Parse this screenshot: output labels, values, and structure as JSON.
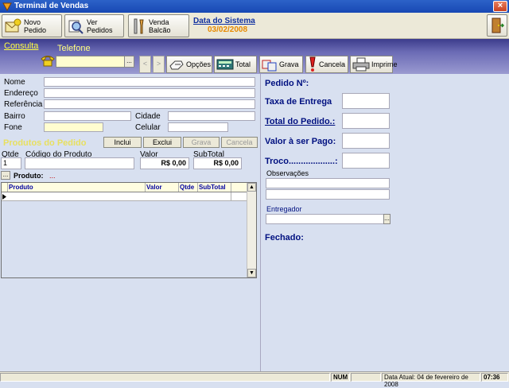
{
  "window": {
    "title": "Terminal de Vendas"
  },
  "toolbar": {
    "novo_pedido": "Novo Pedido",
    "ver_pedidos": "Ver Pedidos",
    "venda_balcao": "Venda Balcão",
    "sysdate_label": "Data do Sistema",
    "sysdate_value": "03/02/2008"
  },
  "consulta": {
    "link": "Consulta",
    "phone_label": "Telefone",
    "phone_value": "",
    "lookup": "...",
    "nav_prev": "<",
    "nav_next": ">",
    "opcoes": "Opções",
    "total": "Total",
    "grava": "Grava",
    "cancela": "Cancela",
    "imprime": "Imprime"
  },
  "customer": {
    "nome": "Nome",
    "endereco": "Endereço",
    "referencia": "Referência",
    "bairro": "Bairro",
    "cidade": "Cidade",
    "fone": "Fone",
    "celular": "Celular"
  },
  "products": {
    "title": "Produtos do Pedido",
    "inclui": "Inclui",
    "exclui": "Exclui",
    "grava": "Grava",
    "cancela": "Cancela",
    "qtde_label": "Qtde",
    "codigo_label": "Código do Produto",
    "valor_label": "Valor",
    "subtotal_label": "SubTotal",
    "qtde_value": "1",
    "valor_value": "R$ 0,00",
    "subtotal_value": "R$ 0,00",
    "produto_lookup": "...",
    "produto_label": "Produto:",
    "produto_value": "...",
    "grid_columns": [
      "Produto",
      "Valor",
      "Qtde",
      "SubTotal"
    ]
  },
  "order": {
    "pedido_no": "Pedido Nº:",
    "taxa_entrega": "Taxa de Entrega",
    "total_pedido": "Total do Pedido.:",
    "valor_pago": "Valor à ser Pago:",
    "troco": "Troco...................:",
    "observacoes": "Observações",
    "entregador": "Entregador",
    "entregador_lookup": "...",
    "fechado": "Fechado:"
  },
  "status": {
    "num": "NUM",
    "data_atual": "Data Atual: 04 de fevereiro de 2008",
    "time": "07:36"
  },
  "colors": {
    "titlebar": "#2050c0",
    "band": "#5a5aa8",
    "label_blue": "#001080",
    "highlight_yellow": "#e8e060",
    "date_orange": "#e88a00"
  }
}
